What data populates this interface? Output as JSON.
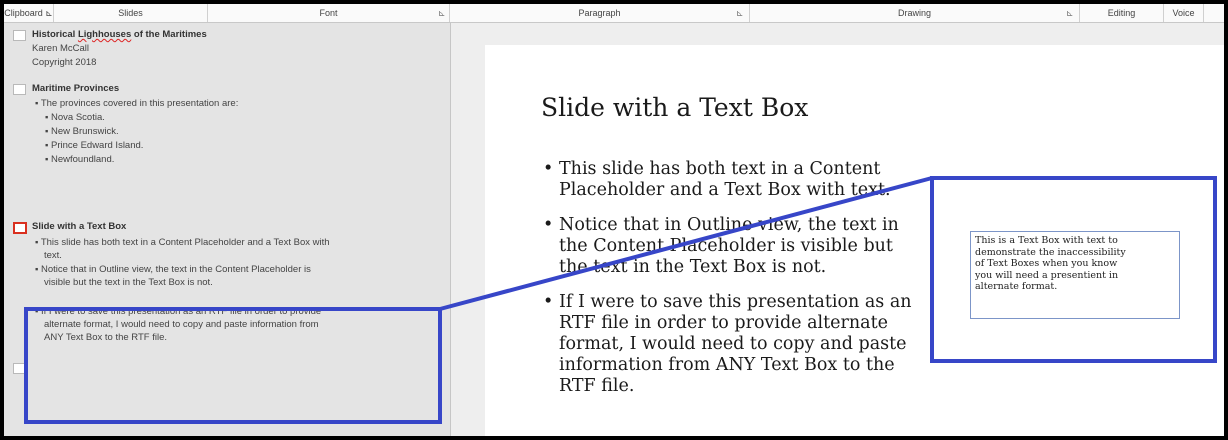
{
  "ribbon": {
    "groups": [
      "Clipboard",
      "Slides",
      "Font",
      "Paragraph",
      "Drawing",
      "Editing",
      "Voice"
    ],
    "launcher_glyph": "⊾"
  },
  "outline": {
    "slide1": {
      "title_word1": "Historical",
      "title_word2": "Lighhouses",
      "title_rest": "of the Maritimes",
      "line2": "Karen McCall",
      "line3": "Copyright 2018"
    },
    "slide2": {
      "title": "Maritime Provinces",
      "bullets": [
        "▪ The provinces covered in this presentation are:",
        "▪ Nova Scotia.",
        "▪ New Brunswick.",
        "▪ Prince Edward Island.",
        "▪ Newfoundland."
      ]
    },
    "slide3": {
      "title": "Slide with a Text Box",
      "lines": [
        "▪ This slide has both text in a Content Placeholder and a Text Box with",
        "text.",
        "▪ Notice that in Outline view, the text in the Content Placeholder is",
        "visible but the text in the Text Box is not.",
        "▪ If I were to save this presentation as an RTF file in order to provide",
        "alternate format, I would need to copy and paste information from",
        "ANY Text Box to the RTF file."
      ]
    }
  },
  "slide": {
    "title": "Slide with a Text Box",
    "bullet_glyph": "•",
    "bullets": [
      [
        "This slide has both text in a Content",
        "Placeholder and a Text Box with text."
      ],
      [
        "Notice that in Outline view, the text in",
        "the Content Placeholder is visible but",
        "the text in the Text Box is not."
      ],
      [
        "If I were to save this presentation as an",
        "RTF file in order to provide alternate",
        "format, I would need to copy and paste",
        "information from ANY Text Box to the",
        "RTF file."
      ]
    ],
    "text_box_lines": [
      "This is a Text Box with text to",
      "demonstrate the inaccessibility",
      "of Text Boxes when you know",
      "you will need a presentient in",
      "alternate format."
    ]
  },
  "colors": {
    "highlight": "#3746c8",
    "active_slide_icon": "#d9301f"
  }
}
